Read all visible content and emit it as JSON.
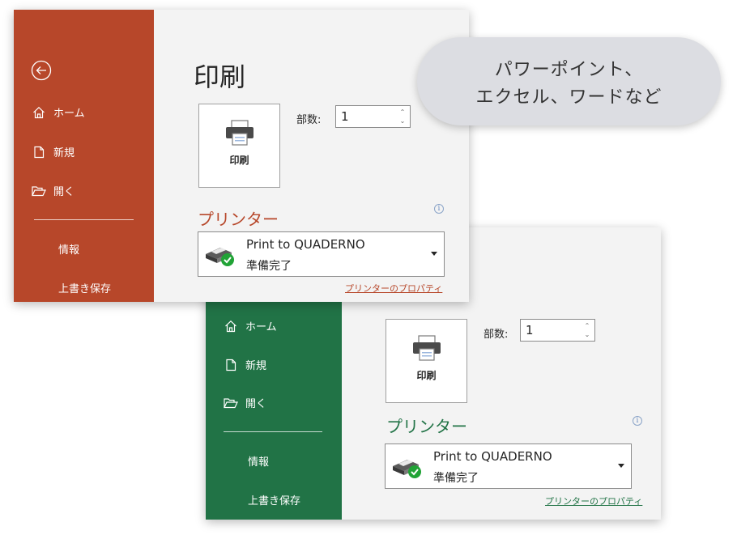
{
  "colors": {
    "powerpoint_accent": "#b7472a",
    "excel_accent": "#217346",
    "window_background": "#f3f3f3",
    "bubble_background": "#dcdde2"
  },
  "callout": {
    "line1": "パワーポイント、",
    "line2": "エクセル、ワードなど"
  },
  "excel_window": {
    "sidebar": {
      "home": {
        "label": "ホーム",
        "icon": "home-icon"
      },
      "new": {
        "label": "新規",
        "icon": "new-document-icon"
      },
      "open": {
        "label": "開く",
        "icon": "open-folder-icon"
      },
      "info": "情報",
      "save": "上書き保存"
    },
    "print_button": {
      "label": "印刷",
      "icon": "printer-icon"
    },
    "copies": {
      "label": "部数:",
      "value": "1"
    },
    "printer_heading": "プリンター",
    "printer": {
      "name": "Print to QUADERNO",
      "status": "準備完了",
      "icon": "printer-ready-icon"
    },
    "printer_properties": "プリンターのプロパティ"
  },
  "powerpoint_window": {
    "back_icon": "back-arrow-icon",
    "title": "印刷",
    "sidebar": {
      "home": {
        "label": "ホーム",
        "icon": "home-icon"
      },
      "new": {
        "label": "新規",
        "icon": "new-document-icon"
      },
      "open": {
        "label": "開く",
        "icon": "open-folder-icon"
      },
      "info": "情報",
      "save": "上書き保存"
    },
    "print_button": {
      "label": "印刷",
      "icon": "printer-icon"
    },
    "copies": {
      "label": "部数:",
      "value": "1"
    },
    "printer_heading": "プリンター",
    "printer": {
      "name": "Print to QUADERNO",
      "status": "準備完了",
      "icon": "printer-ready-icon"
    },
    "printer_properties": "プリンターのプロパティ"
  }
}
